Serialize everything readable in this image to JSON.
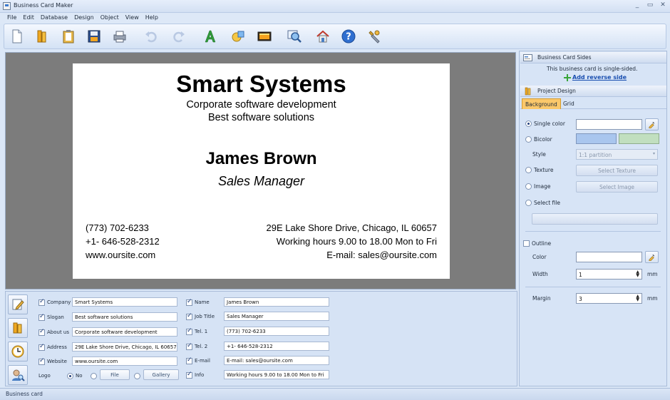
{
  "window": {
    "title": "Business Card Maker",
    "controls": [
      "_",
      "▭",
      "✕"
    ]
  },
  "menu": [
    "File",
    "Edit",
    "Database",
    "Design",
    "Object",
    "View",
    "Help"
  ],
  "toolbar": {
    "icons": [
      "new-file-icon",
      "open-book-icon",
      "clipboard-icon",
      "save-icon",
      "print-icon",
      "undo-icon",
      "redo-icon",
      "text-icon",
      "shapes-icon",
      "image-icon",
      "zoom-icon",
      "home-icon",
      "help-icon",
      "settings-icon"
    ]
  },
  "card": {
    "company": "Smart Systems",
    "about": "Corporate software development",
    "slogan": "Best software solutions",
    "name": "James Brown",
    "job_title": "Sales Manager",
    "tel1": "(773) 702-6233",
    "tel2": "+1- 646-528-2312",
    "website": "www.oursite.com",
    "address": "29E Lake Shore Drive, Chicago, IL 60657",
    "info": "Working hours 9.00 to 18.00 Mon to Fri",
    "email": "E-mail: sales@oursite.com"
  },
  "fields": {
    "left": [
      {
        "label": "Company",
        "value": "Smart Systems"
      },
      {
        "label": "Slogan",
        "value": "Best software solutions"
      },
      {
        "label": "About us",
        "value": "Corporate software development"
      },
      {
        "label": "Address",
        "value": "29E Lake Shore Drive, Chicago, IL 60657"
      },
      {
        "label": "Website",
        "value": "www.oursite.com"
      }
    ],
    "right": [
      {
        "label": "Name",
        "value": "James Brown"
      },
      {
        "label": "Job Title",
        "value": "Sales Manager"
      },
      {
        "label": "Tel. 1",
        "value": "(773) 702-6233"
      },
      {
        "label": "Tel. 2",
        "value": "+1- 646-528-2312"
      },
      {
        "label": "E-mail",
        "value": "E-mail: sales@oursite.com"
      },
      {
        "label": "Info",
        "value": "Working hours 9.00 to 18.00 Mon to Fri"
      }
    ],
    "logo": {
      "label": "Logo",
      "no": "No",
      "file": "File",
      "gallery": "Gallery"
    }
  },
  "sides": {
    "header": "Business Card Sides",
    "status": "This business card is single-sided.",
    "link": "Add reverse side"
  },
  "design": {
    "header": "Project Design",
    "tabs": [
      "Background",
      "Grid"
    ],
    "single_color": "Single color",
    "bicolor": "Bicolor",
    "style_label": "Style",
    "style_value": "1:1 partition",
    "texture": "Texture",
    "select_texture": "Select Texture",
    "image": "Image",
    "select_image": "Select Image",
    "select_file": "Select file",
    "outline": "Outline",
    "color_label": "Color",
    "width_label": "Width",
    "width_value": "1",
    "width_unit": "mm",
    "margin_label": "Margin",
    "margin_value": "3",
    "margin_unit": "mm",
    "bicolor_colors": [
      "#a9c6ee",
      "#c1dfbf"
    ]
  },
  "status": "Business card"
}
